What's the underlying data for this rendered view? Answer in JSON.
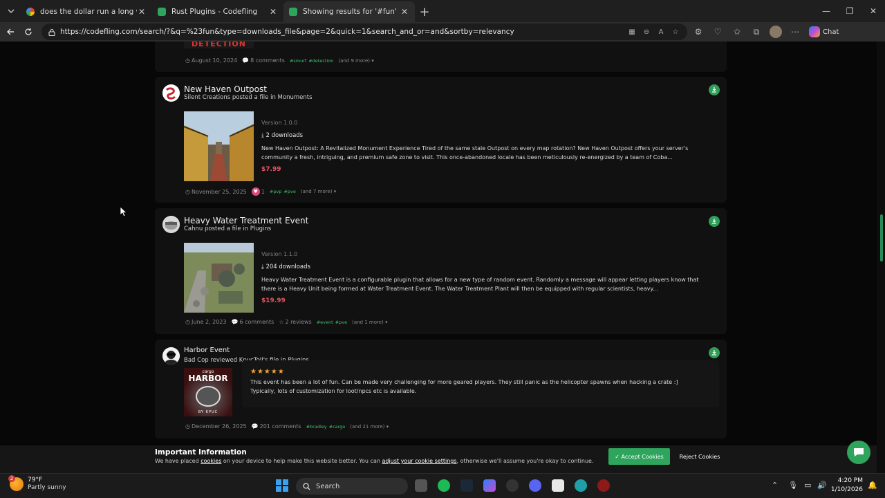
{
  "browser": {
    "tabs": [
      {
        "title": "does the dollar run a long way in J",
        "favicon": "google"
      },
      {
        "title": "Rust Plugins - Codefling",
        "favicon": "codefling"
      },
      {
        "title": "Showing results for '#fun' in files.",
        "favicon": "codefling",
        "active": true
      }
    ],
    "url": "https://codefling.com/search/?&q=%23fun&type=downloads_file&page=2&quick=1&search_and_or=and&sortby=relevancy",
    "chat_label": "Chat"
  },
  "results": [
    {
      "date": "August 10, 2024",
      "comments": "8 comments",
      "tags": [
        "#smurf",
        "#detection"
      ],
      "more": "(and 9 more)",
      "partial_image_text": "DETECTION"
    },
    {
      "title": "New Haven Outpost",
      "byline": "Silent Creations posted a file in Monuments",
      "version": "Version 1.0.0",
      "downloads": "2 downloads",
      "description": "New Haven Outpost: A Revitalized Monument Experience Tired of the same stale Outpost on every map rotation? New Haven Outpost offers your server's community a fresh, intriguing, and premium safe zone to visit. This once-abandoned locale has been meticulously re-energized by a team of Coba...",
      "price": "$7.99",
      "date": "November 25, 2025",
      "likes": "1",
      "tags": [
        "#pvp",
        "#pve"
      ],
      "more": "(and 7 more)"
    },
    {
      "title": "Heavy Water Treatment Event",
      "byline": "Cahnu posted a file in Plugins",
      "version": "Version 1.1.0",
      "downloads": "204 downloads",
      "description": "Heavy Water Treatment Event is a configurable plugin that allows for a new type of random event. Randomly a message will appear letting players know that there is a Heavy Unit being formed at Water Treatment Event. The Water Treatment Plant will then be equipped with regular scientists, heavy...",
      "price": "$19.99",
      "date": "June 2, 2023",
      "comments": "6 comments",
      "reviews": "2 reviews",
      "tags": [
        "#event",
        "#pve"
      ],
      "more": "(and 1 more)"
    },
    {
      "title": "Harbor Event",
      "byline": "Bad Cop reviewed KpucToJI's file in Plugins",
      "rating": 5,
      "review": "This event has been a lot of fun. Can be made very challenging for more geared players. They still panic as the helicopter spawns when hacking a crate :] Typically, lots of customization for loot/npcs etc is available.",
      "image_text_top": "cargo",
      "image_text_main": "HARBOR",
      "image_text_bottom": "BY KPUC",
      "date": "December 26, 2025",
      "comments": "201 comments",
      "tags": [
        "#bradley",
        "#cargo"
      ],
      "more": "(and 21 more)"
    }
  ],
  "cookie": {
    "heading": "Important Information",
    "text_before": "We have placed ",
    "link1": "cookies",
    "text_mid": " on your device to help make this website better. You can ",
    "link2": "adjust your cookie settings",
    "text_after": ", otherwise we'll assume you're okay to continue.",
    "accept": "Accept Cookies",
    "reject": "Reject Cookies"
  },
  "taskbar": {
    "weather_temp": "79°F",
    "weather_cond": "Partly sunny",
    "weather_badge": "2",
    "search_placeholder": "Search",
    "time": "4:20 PM",
    "date": "1/10/2026"
  },
  "colors": {
    "accent": "#2fa45d",
    "price": "#e25563",
    "tag": "#3ec26b",
    "star": "#f2a33a"
  }
}
